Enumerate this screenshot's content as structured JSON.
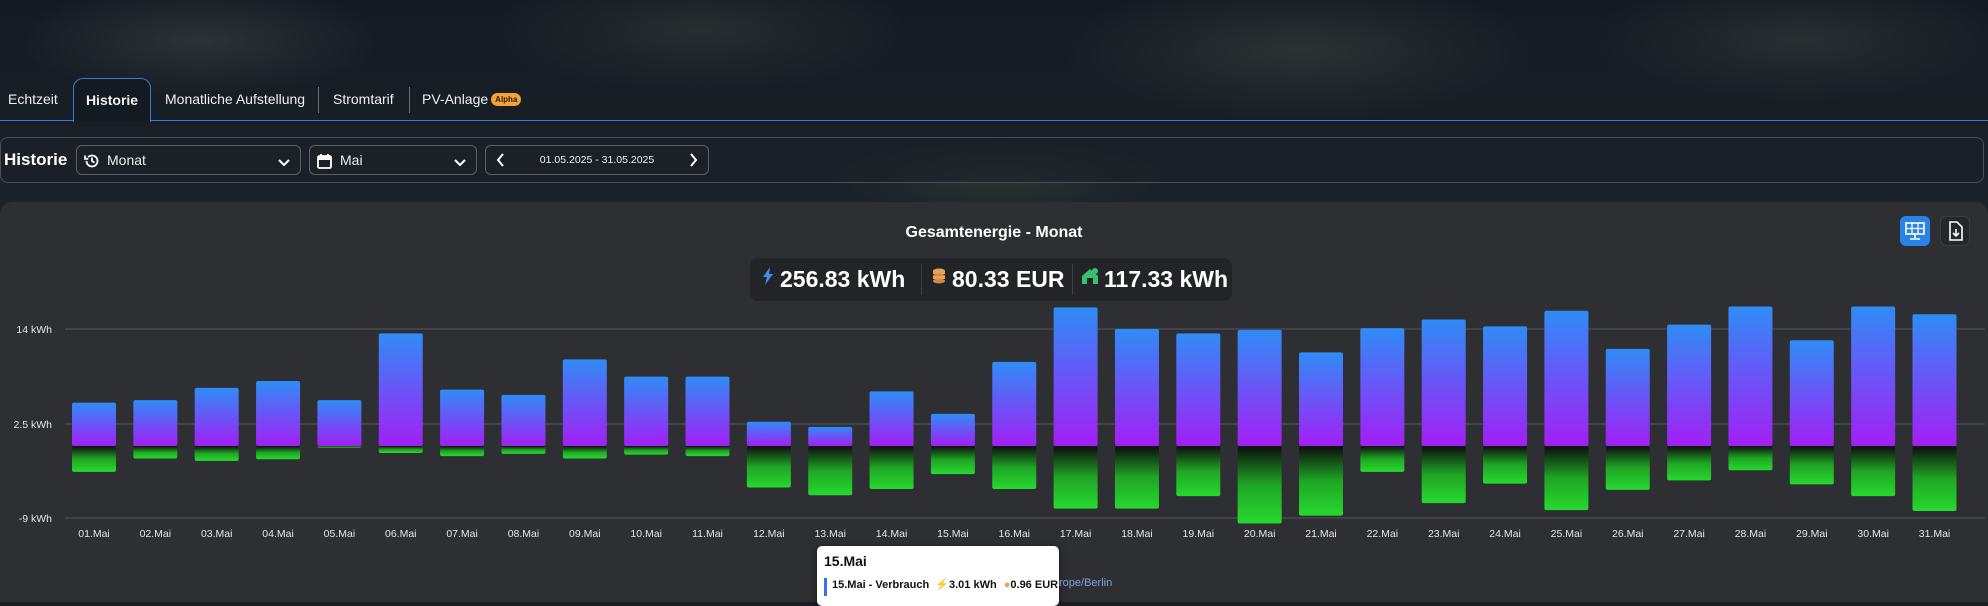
{
  "tabs": [
    {
      "label": "Echtzeit"
    },
    {
      "label": "Historie"
    },
    {
      "label": "Monatliche Aufstellung"
    },
    {
      "label": "Stromtarif"
    },
    {
      "label": "PV-Anlage",
      "badge": "Alpha"
    }
  ],
  "active_tab": "Historie",
  "toolbar": {
    "title": "Historie",
    "period_select": "Monat",
    "month_select": "Mai",
    "date_range": "01.05.2025 - 31.05.2025"
  },
  "panel": {
    "title": "Gesamtenergie - Monat",
    "stats": [
      {
        "icon": "lightning-icon",
        "value": "256.83 kWh",
        "color": "#3d8ef5"
      },
      {
        "icon": "coins-icon",
        "value": "80.33 EUR",
        "color": "#e7a35c"
      },
      {
        "icon": "house-solar-icon",
        "value": "117.33 kWh",
        "color": "#39c06a"
      }
    ]
  },
  "chart_data": {
    "type": "bar",
    "categories": [
      "01.Mai",
      "02.Mai",
      "03.Mai",
      "04.Mai",
      "05.Mai",
      "06.Mai",
      "07.Mai",
      "08.Mai",
      "09.Mai",
      "10.Mai",
      "11.Mai",
      "12.Mai",
      "13.Mai",
      "14.Mai",
      "15.Mai",
      "16.Mai",
      "17.Mai",
      "18.Mai",
      "19.Mai",
      "20.Mai",
      "21.Mai",
      "22.Mai",
      "23.Mai",
      "24.Mai",
      "25.Mai",
      "26.Mai",
      "27.Mai",
      "28.Mai",
      "29.Mai",
      "30.Mai",
      "31.Mai"
    ],
    "series": [
      {
        "values": [
          5.0,
          5.3,
          6.7,
          7.5,
          5.3,
          13.0,
          6.5,
          5.9,
          10.0,
          8.0,
          8.0,
          2.8,
          2.2,
          6.3,
          3.7,
          9.7,
          16.0,
          13.5,
          13.0,
          13.4,
          10.8,
          13.6,
          14.6,
          13.8,
          15.6,
          11.2,
          14.0,
          16.1,
          12.2,
          16.1,
          15.2
        ],
        "color_top": "#2f8cf6",
        "color_bottom": "#a31ff5"
      },
      {
        "values": [
          -3.3,
          -1.6,
          -1.9,
          -1.7,
          -0.2,
          -0.9,
          -1.3,
          -1.0,
          -1.6,
          -1.1,
          -1.3,
          -5.3,
          -6.3,
          -5.5,
          -3.6,
          -5.5,
          -8.0,
          -8.0,
          -6.4,
          -9.9,
          -8.9,
          -3.3,
          -7.3,
          -4.8,
          -8.2,
          -5.6,
          -4.4,
          -3.1,
          -4.9,
          -6.4,
          -8.3
        ],
        "color_top": "#0c0c0c",
        "color_bottom": "#26d92e"
      }
    ],
    "y_ticks": [
      "14 kWh",
      "2.5 kWh",
      "-9 kWh"
    ],
    "ylim": [
      -9,
      14
    ]
  },
  "tooltip": {
    "title": "15.Mai",
    "line_label": "15.Mai - Verbrauch",
    "energy": "3.01 kWh",
    "cost": "0.96 EUR"
  },
  "timezone": "rope/Berlin"
}
